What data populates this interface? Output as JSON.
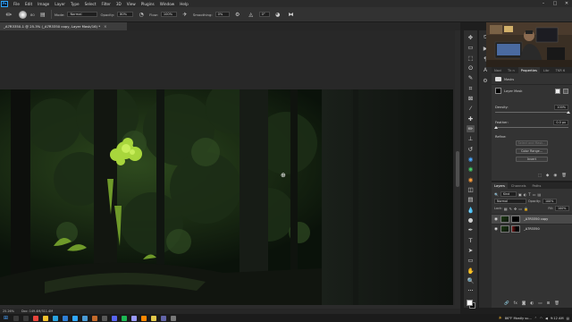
{
  "app": {
    "logo_text": "Ps"
  },
  "menubar": {
    "items": [
      "File",
      "Edit",
      "Image",
      "Layer",
      "Type",
      "Select",
      "Filter",
      "3D",
      "View",
      "Plugins",
      "Window",
      "Help"
    ],
    "window_controls": {
      "minimize": "–",
      "maximize": "□",
      "close": "✕"
    }
  },
  "options_bar": {
    "brush_size": "80",
    "mode_label": "Mode:",
    "mode_value": "Normal",
    "opacity_label": "Opacity:",
    "opacity_value": "80%",
    "flow_label": "Flow:",
    "flow_value": "100%",
    "smoothing_label": "Smoothing:",
    "smoothing_value": "0%",
    "angle_value": "0°",
    "icons": [
      "brush-tool-icon",
      "brush-preset-icon",
      "brush-settings-icon",
      "pressure-opacity-icon",
      "airbrush-icon",
      "smoothing-options-icon",
      "angle-icon",
      "pressure-size-icon",
      "symmetry-icon"
    ]
  },
  "document": {
    "tab_title": "_A7R3350-1 @ 25.3% (_A7R3350 copy, Layer Mask/16) *",
    "tab_close": "×",
    "zoom": "25.26%",
    "doc_info": "Doc: 149.4M/311.4M",
    "cursor_glyph": "⊕"
  },
  "toolbar": {
    "tools": [
      {
        "name": "move-tool-icon",
        "glyph": "✥"
      },
      {
        "name": "artboard-tool-icon",
        "glyph": "▭"
      },
      {
        "name": "marquee-tool-icon",
        "glyph": "⬚"
      },
      {
        "name": "lasso-tool-icon",
        "glyph": "ʘ"
      },
      {
        "name": "quick-select-tool-icon",
        "glyph": "✎"
      },
      {
        "name": "crop-tool-icon",
        "glyph": "⌗"
      },
      {
        "name": "frame-tool-icon",
        "glyph": "⊠"
      },
      {
        "name": "eyedropper-tool-icon",
        "glyph": "⁄"
      },
      {
        "name": "spot-healing-tool-icon",
        "glyph": "✚"
      },
      {
        "name": "brush-tool-icon",
        "glyph": "✏",
        "active": true
      },
      {
        "name": "clone-stamp-tool-icon",
        "glyph": "⊥"
      },
      {
        "name": "history-brush-tool-icon",
        "glyph": "↺"
      },
      {
        "name": "plugin-blue-icon",
        "glyph": "◉",
        "color": "blue"
      },
      {
        "name": "plugin-green-icon",
        "glyph": "◉",
        "color": "green"
      },
      {
        "name": "plugin-orange-icon",
        "glyph": "◉",
        "color": "orange"
      },
      {
        "name": "eraser-tool-icon",
        "glyph": "◫"
      },
      {
        "name": "gradient-tool-icon",
        "glyph": "▤"
      },
      {
        "name": "blur-tool-icon",
        "glyph": "💧"
      },
      {
        "name": "dodge-tool-icon",
        "glyph": "●"
      },
      {
        "name": "pen-tool-icon",
        "glyph": "✒"
      },
      {
        "name": "type-tool-icon",
        "glyph": "T"
      },
      {
        "name": "path-select-tool-icon",
        "glyph": "➤"
      },
      {
        "name": "rectangle-tool-icon",
        "glyph": "▭"
      },
      {
        "name": "hand-tool-icon",
        "glyph": "✋"
      },
      {
        "name": "zoom-tool-icon",
        "glyph": "🔍"
      },
      {
        "name": "more-tools-icon",
        "glyph": "•••"
      }
    ],
    "foreground_color": "#ffffff",
    "background_color": "#000000"
  },
  "side_strip": {
    "icons": [
      {
        "name": "history-panel-icon",
        "glyph": "⏲"
      },
      {
        "name": "actions-panel-icon",
        "glyph": "▶"
      },
      {
        "name": "paragraph-panel-icon",
        "glyph": "¶"
      },
      {
        "name": "character-panel-icon",
        "glyph": "A"
      },
      {
        "name": "glyphs-panel-icon",
        "glyph": "⚙"
      }
    ]
  },
  "properties_panel": {
    "tabs": [
      {
        "label": "Navi",
        "active": false
      },
      {
        "label": "Tk n",
        "active": false
      },
      {
        "label": "Properties",
        "active": true
      },
      {
        "label": "Libr",
        "active": false
      },
      {
        "label": "TKR 6",
        "active": false
      }
    ],
    "masks_label": "Masks",
    "layer_mask_label": "Layer Mask",
    "density_label": "Density:",
    "density_value": "100%",
    "feather_label": "Feather:",
    "feather_value": "0.0 px",
    "refine_label": "Refine:",
    "select_mask_button": "Select and Mask...",
    "color_range_button": "Color Range...",
    "invert_button": "Invert"
  },
  "layers_panel": {
    "tabs": [
      {
        "label": "Layers",
        "active": true
      },
      {
        "label": "Channels",
        "active": false
      },
      {
        "label": "Paths",
        "active": false
      }
    ],
    "filter_value": "Kind",
    "blend_mode": "Normal",
    "opacity_label": "Opacity:",
    "opacity_value": "100%",
    "lock_label": "Lock:",
    "fill_label": "Fill:",
    "fill_value": "100%",
    "layers": [
      {
        "name": "_A7R3350 copy",
        "visible": true,
        "selected": true,
        "has_mask": true
      },
      {
        "name": "_A7R3350",
        "visible": true,
        "selected": false,
        "has_mask": true
      }
    ],
    "footer_icons": [
      "link-layers-icon",
      "fx-icon",
      "add-mask-icon",
      "adjustment-icon",
      "group-icon",
      "new-layer-icon",
      "delete-layer-icon"
    ],
    "footer_glyphs": [
      "🔗",
      "fx",
      "◙",
      "◐",
      "▭",
      "⊞",
      "🗑"
    ]
  },
  "taskbar": {
    "weather": "86°F  Mostly su...",
    "time": "9:12 AM",
    "apps": [
      {
        "name": "search-taskbar-icon",
        "color": "#3a3a3a"
      },
      {
        "name": "task-view-taskbar-icon",
        "color": "#3a3a3a"
      },
      {
        "name": "chrome-taskbar-icon",
        "color": "#e8453c"
      },
      {
        "name": "explorer-taskbar-icon",
        "color": "#f2c12e"
      },
      {
        "name": "edge-taskbar-icon",
        "color": "#2aa3e0"
      },
      {
        "name": "mail-taskbar-icon",
        "color": "#2f7fd6"
      },
      {
        "name": "photoshop-taskbar-icon",
        "color": "#31a8ff"
      },
      {
        "name": "lightroom-taskbar-icon",
        "color": "#4a9bd6"
      },
      {
        "name": "bridge-taskbar-icon",
        "color": "#c46a2b"
      },
      {
        "name": "obs-taskbar-icon",
        "color": "#595959"
      },
      {
        "name": "discord-taskbar-icon",
        "color": "#5865f2"
      },
      {
        "name": "spotify-taskbar-icon",
        "color": "#1db954"
      },
      {
        "name": "premiere-taskbar-icon",
        "color": "#9999ff"
      },
      {
        "name": "vlc-taskbar-icon",
        "color": "#ff8800"
      },
      {
        "name": "notes-taskbar-icon",
        "color": "#e3c84a"
      },
      {
        "name": "teams-taskbar-icon",
        "color": "#6264a7"
      },
      {
        "name": "settings-taskbar-icon",
        "color": "#777777"
      }
    ]
  }
}
